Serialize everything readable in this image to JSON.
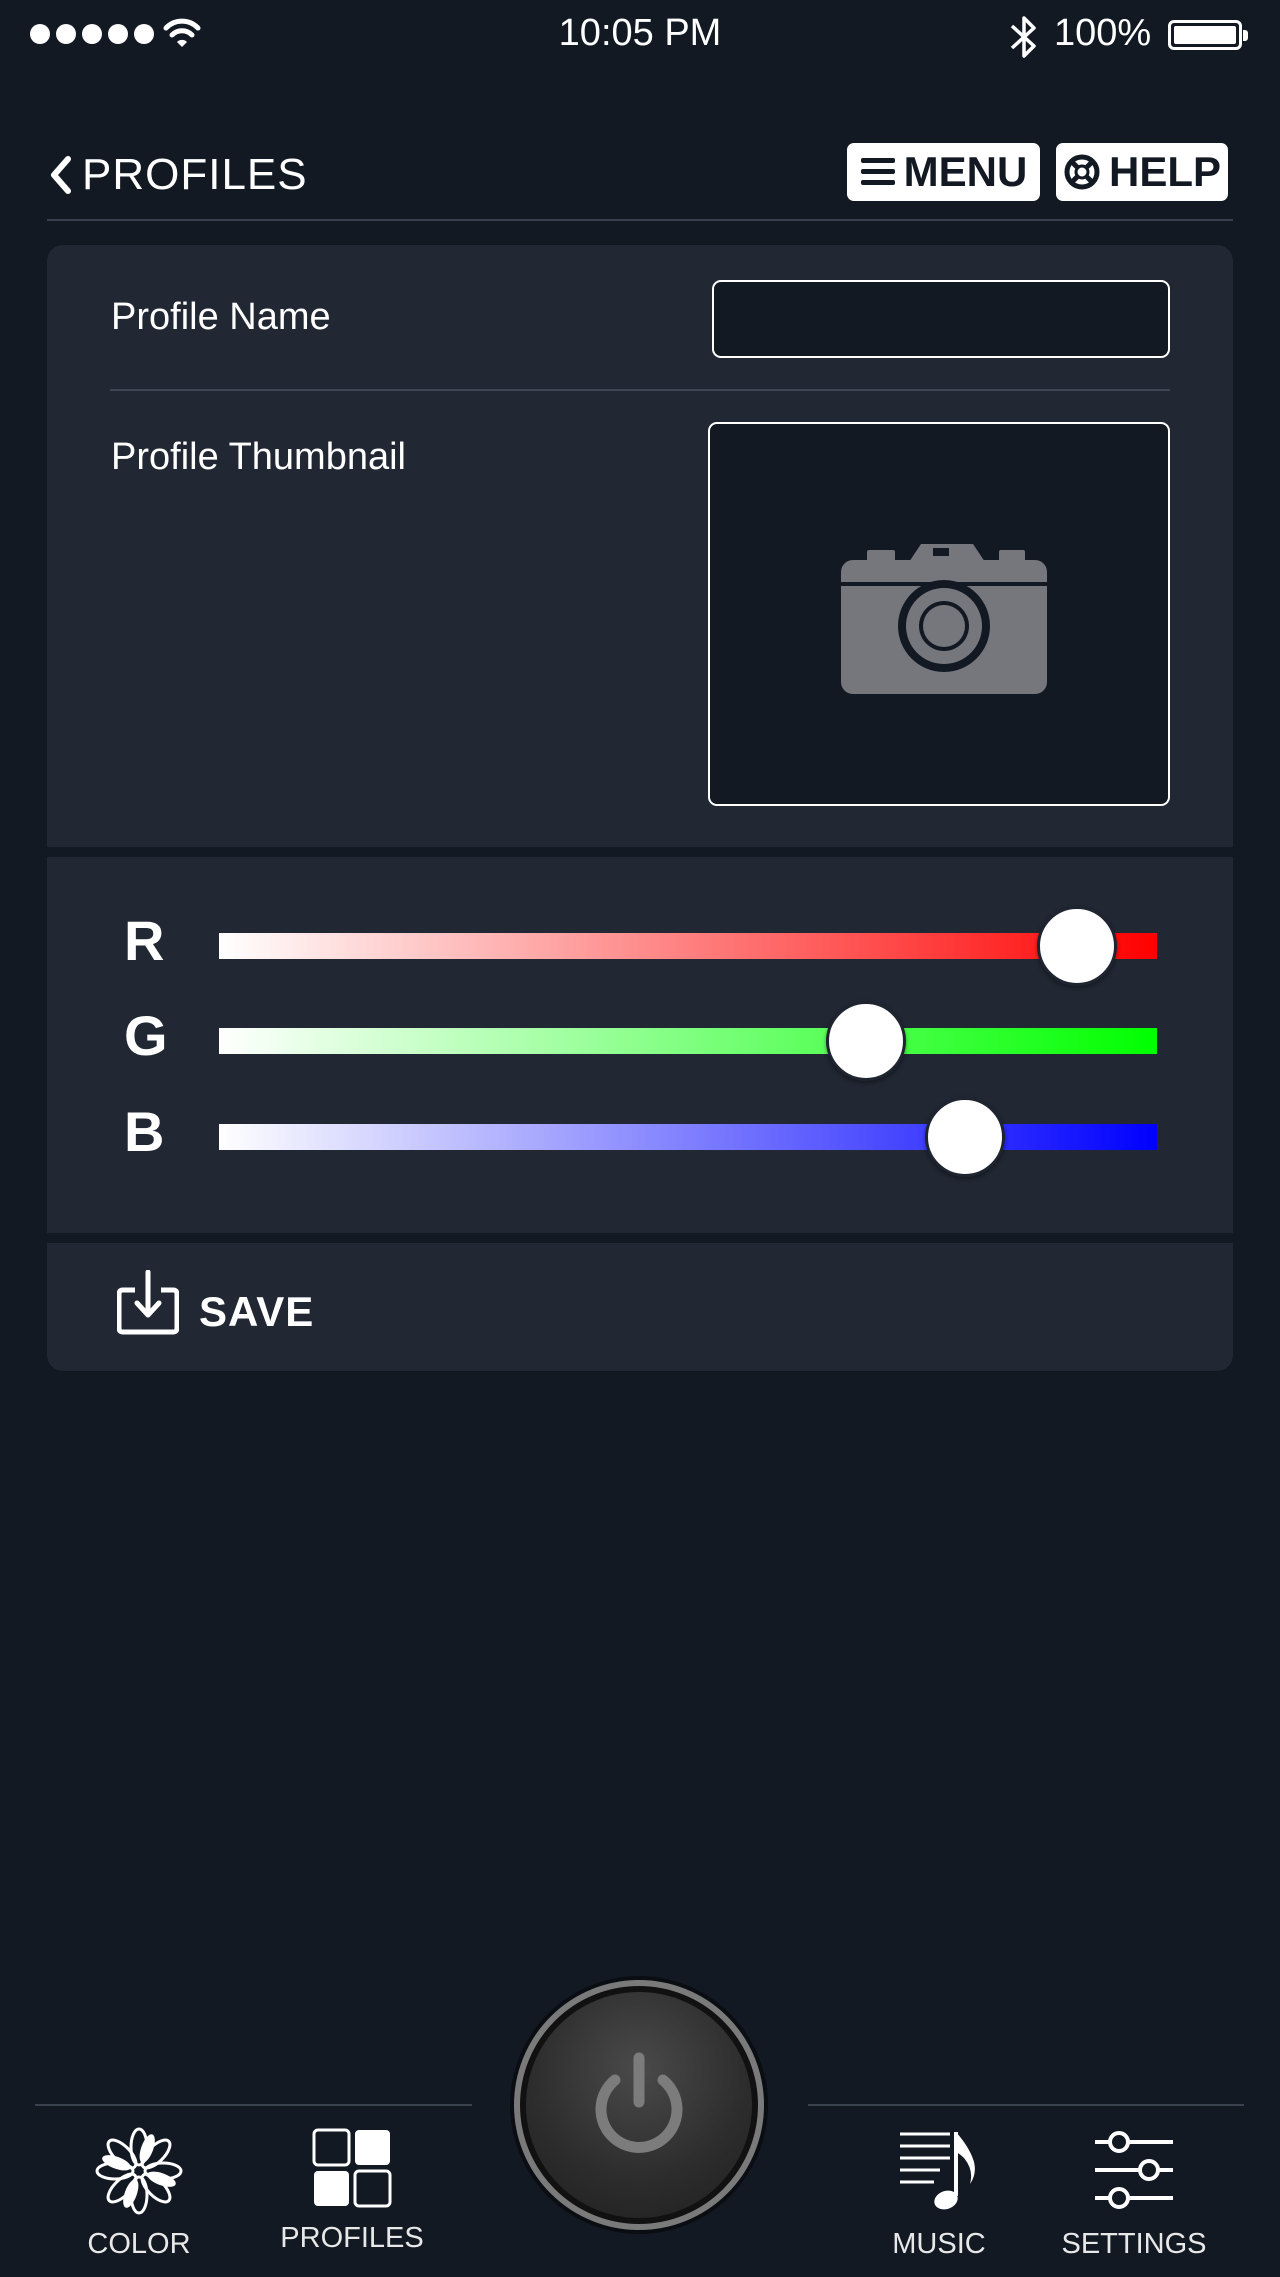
{
  "status_bar": {
    "signal_dots": 5,
    "time": "10:05 PM",
    "battery": "100%",
    "icons": [
      "signal-dots-icon",
      "wifi-icon",
      "bluetooth-icon",
      "battery-icon"
    ]
  },
  "header": {
    "back_label": "PROFILES",
    "menu_label": "MENU",
    "help_label": "HELP"
  },
  "profile": {
    "name_label": "Profile Name",
    "name_value": "",
    "thumbnail_label": "Profile Thumbnail",
    "thumbnail_icon": "camera-icon"
  },
  "rgb": {
    "channels": [
      {
        "label": "R",
        "color": "#ff0000",
        "value": 0.915
      },
      {
        "label": "G",
        "color": "#00ff00",
        "value": 0.69
      },
      {
        "label": "B",
        "color": "#0000ff",
        "value": 0.795
      }
    ]
  },
  "save": {
    "label": "SAVE",
    "icon": "save-icon"
  },
  "nav": {
    "items": [
      {
        "label": "COLOR",
        "icon": "flower-icon"
      },
      {
        "label": "PROFILES",
        "icon": "grid-icon"
      },
      {
        "label": "MUSIC",
        "icon": "music-icon"
      },
      {
        "label": "SETTINGS",
        "icon": "sliders-icon"
      }
    ],
    "power_icon": "power-icon"
  },
  "colors": {
    "background": "#131923",
    "panel": "#212733",
    "text": "#ffffff"
  }
}
